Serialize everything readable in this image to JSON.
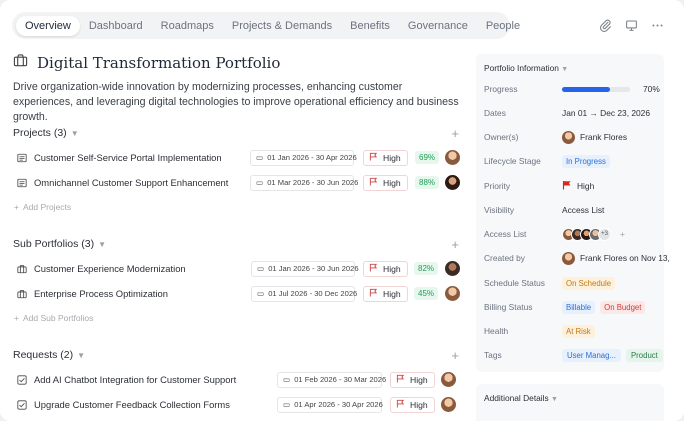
{
  "tabs": [
    {
      "label": "Overview",
      "active": true
    },
    {
      "label": "Dashboard"
    },
    {
      "label": "Roadmaps"
    },
    {
      "label": "Projects & Demands"
    },
    {
      "label": "Benefits"
    },
    {
      "label": "Governance"
    },
    {
      "label": "People"
    }
  ],
  "top_icons": [
    "paperclip-icon",
    "presentation-icon",
    "more-icon"
  ],
  "page": {
    "title": "Digital Transformation Portfolio",
    "description": "Drive organization-wide innovation by modernizing processes, enhancing customer experiences, and leveraging digital technologies to improve operational efficiency and business growth."
  },
  "projects": {
    "header": "Projects (3)",
    "add_label": "Add Projects",
    "items": [
      {
        "name": "Customer Self-Service Portal Implementation",
        "dates": "01 Jan 2026 - 30 Apr 2026",
        "priority": "High",
        "percent": "69%"
      },
      {
        "name": "Omnichannel Customer Support Enhancement",
        "dates": "01 Mar 2026 - 30 Jun 2026",
        "priority": "High",
        "percent": "88%"
      }
    ]
  },
  "subportfolios": {
    "header": "Sub Portfolios (3)",
    "add_label": "Add Sub Portfolios",
    "items": [
      {
        "name": "Customer Experience Modernization",
        "dates": "01 Jan 2026 - 30 Jun 2026",
        "priority": "High",
        "percent": "82%"
      },
      {
        "name": "Enterprise Process Optimization",
        "dates": "01 Jul 2026 - 30 Dec 2026",
        "priority": "High",
        "percent": "45%"
      }
    ]
  },
  "requests": {
    "header": "Requests (2)",
    "items": [
      {
        "name": "Add AI Chatbot Integration for Customer Support",
        "dates": "01 Feb 2026 - 30 Mar 2026",
        "priority": "High"
      },
      {
        "name": "Upgrade Customer Feedback Collection Forms",
        "dates": "01 Apr 2026 - 30 Apr 2026",
        "priority": "High"
      }
    ]
  },
  "portfolio_info": {
    "header": "Portfolio Information",
    "progress_label": "Progress",
    "progress_value": "70%",
    "progress_fraction": 0.7,
    "dates_label": "Dates",
    "dates_value": "Jan 01 → Dec 23, 2026",
    "owner_label": "Owner(s)",
    "owner_value": "Frank Flores",
    "lifecycle_label": "Lifecycle Stage",
    "lifecycle_value": "In Progress",
    "priority_label": "Priority",
    "priority_value": "High",
    "visibility_label": "Visibility",
    "visibility_value": "Access List",
    "access_label": "Access List",
    "access_more": "+3",
    "created_label": "Created by",
    "created_value": "Frank Flores on Nov 13,",
    "schedule_label": "Schedule Status",
    "schedule_value": "On Schedule",
    "billing_label": "Billing Status",
    "billing_value1": "Billable",
    "billing_value2": "On Budget",
    "health_label": "Health",
    "health_value": "At Risk",
    "tags_label": "Tags",
    "tag1": "User Manag...",
    "tag2": "Product"
  },
  "additional": {
    "header": "Additional Details"
  },
  "colors": {
    "accent": "#2563eb",
    "high_flag": "#dc2626",
    "percent_green": "#1e9e55"
  }
}
